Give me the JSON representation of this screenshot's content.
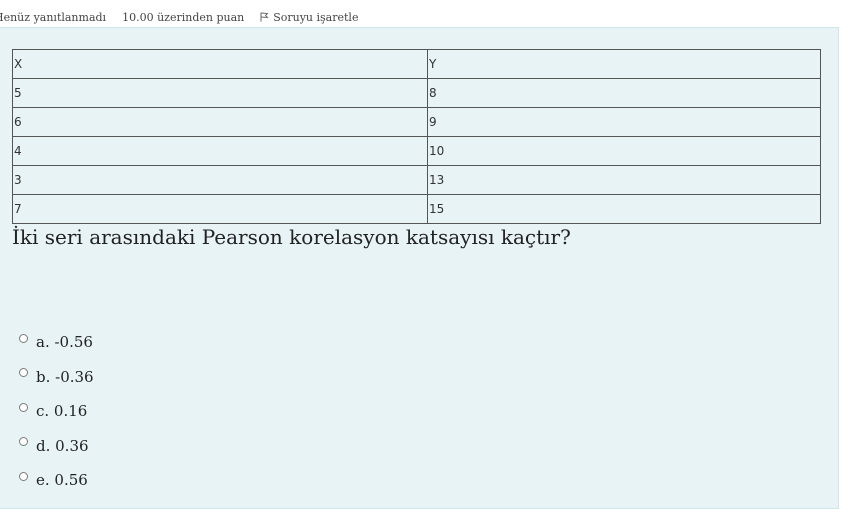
{
  "info": {
    "status": "Henüz yanıtlanmadı",
    "points": "10.00 üzerinden puan",
    "flag_label": "Soruyu işaretle",
    "flag_icon": "flag-icon"
  },
  "table": {
    "headers": [
      "X",
      "Y"
    ],
    "rows": [
      [
        "5",
        "8"
      ],
      [
        "6",
        "9"
      ],
      [
        "4",
        "10"
      ],
      [
        "3",
        "13"
      ],
      [
        "7",
        "15"
      ]
    ]
  },
  "question": "İki seri arasındaki Pearson korelasyon katsayısı kaçtır?",
  "answers": [
    {
      "label": "a. -0.56",
      "selected": false
    },
    {
      "label": "b. -0.36",
      "selected": false
    },
    {
      "label": "c. 0.16",
      "selected": false
    },
    {
      "label": "d. 0.36",
      "selected": false
    },
    {
      "label": "e. 0.56",
      "selected": false
    }
  ],
  "colors": {
    "panel_background": "#e7f3f5",
    "panel_border": "#cfe6ea",
    "table_border": "#555555"
  }
}
